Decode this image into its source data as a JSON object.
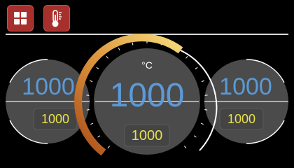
{
  "toolbar": {
    "buttons": [
      {
        "icon": "grid-icon"
      },
      {
        "icon": "thermometer-icon"
      }
    ]
  },
  "colors": {
    "button_bg": "#a8302c",
    "gauge_face": "#4a4a4a",
    "big_value": "#5b9ad6",
    "small_value": "#e8e14a",
    "arc_start": "#b5541e",
    "arc_end": "#f5d06a"
  },
  "gauges": {
    "left": {
      "value": "1000",
      "setpoint": "1000"
    },
    "center": {
      "unit": "°C",
      "value": "1000",
      "setpoint": "1000",
      "level": 0.6
    },
    "right": {
      "value": "1000",
      "setpoint": "1000"
    }
  }
}
